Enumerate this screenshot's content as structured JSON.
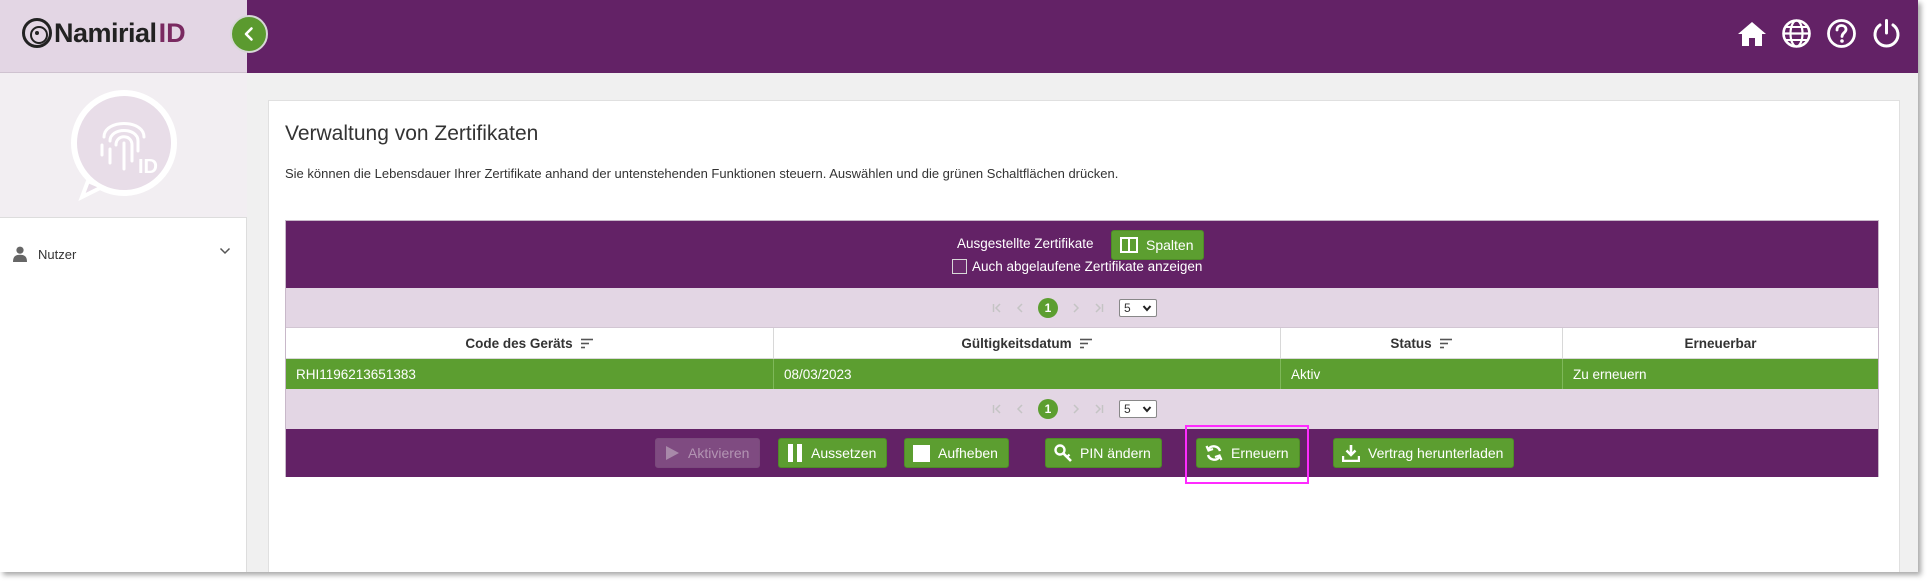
{
  "brand": {
    "name": "Namirial",
    "suffix": "ID"
  },
  "topbar": {
    "icons": [
      "home-icon",
      "globe-icon",
      "help-icon",
      "power-icon"
    ]
  },
  "sidebar": {
    "nav": [
      {
        "label": "Nutzer",
        "icon": "user-icon"
      }
    ]
  },
  "main": {
    "title": "Verwaltung von Zertifikaten",
    "description": "Sie können die Lebensdauer Ihrer Zertifikate anhand der untenstehenden Funktionen steuern. Auswählen und die grünen Schaltflächen drücken."
  },
  "panel": {
    "title": "Ausgestellte Zertifikate",
    "columns_button": "Spalten",
    "show_expired_label": "Auch abgelaufene Zertifikate anzeigen",
    "show_expired_checked": false
  },
  "pager": {
    "current_page": "1",
    "page_size": "5"
  },
  "table": {
    "columns": [
      "Code des Geräts",
      "Gültigkeitsdatum",
      "Status",
      "Erneuerbar"
    ],
    "rows": [
      {
        "code": "RHI1196213651383",
        "valid_date": "08/03/2023",
        "status": "Aktiv",
        "renewable": "Zu erneuern"
      }
    ]
  },
  "actions": {
    "activate": "Aktivieren",
    "suspend": "Aussetzen",
    "revoke": "Aufheben",
    "change_pin": "PIN ändern",
    "renew": "Erneuern",
    "download_contract": "Vertrag herunterladen"
  },
  "colors": {
    "primary": "#632266",
    "accent": "#5c9e30",
    "light": "#e3d6e4",
    "highlight": "#ff2bff"
  }
}
